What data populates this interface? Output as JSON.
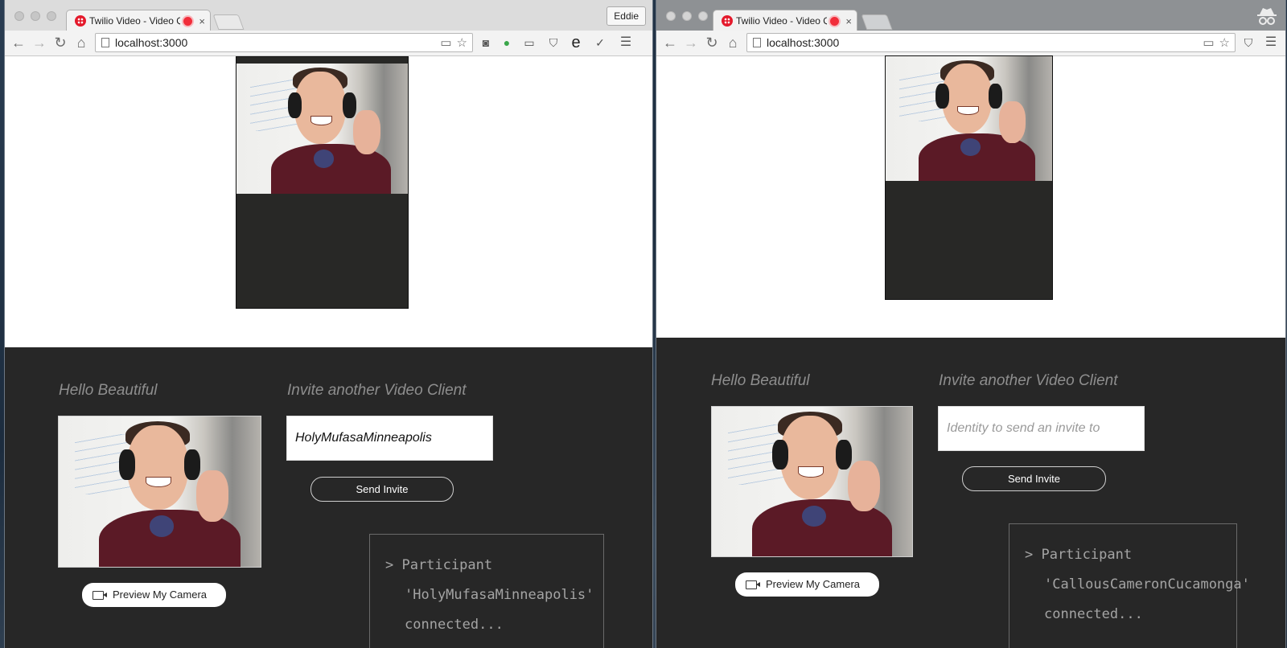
{
  "windows": [
    {
      "tab_title": "Twilio Video - Video Qu",
      "profile_name": "Eddie",
      "url": "localhost:3000",
      "heading_hello": "Hello Beautiful",
      "heading_invite": "Invite another Video Client",
      "invite_value": "HolyMufasaMinneapolis",
      "invite_placeholder": "Identity to send an invite to",
      "send_invite_label": "Send Invite",
      "preview_label": "Preview My Camera",
      "log_line1": "> Participant",
      "log_line2": "'HolyMufasaMinneapolis'",
      "log_line3": "connected..."
    },
    {
      "tab_title": "Twilio Video - Video Qu",
      "url": "localhost:3000",
      "heading_hello": "Hello Beautiful",
      "heading_invite": "Invite another Video Client",
      "invite_value": "",
      "invite_placeholder": "Identity to send an invite to",
      "send_invite_label": "Send Invite",
      "preview_label": "Preview My Camera",
      "log_line1": "> Participant",
      "log_line2": "'CallousCameronCucamonga'",
      "log_line3": "connected..."
    }
  ],
  "icons": {
    "back": "←",
    "forward": "→",
    "reload": "↻",
    "home": "⌂",
    "star": "☆",
    "menu": "☰",
    "close": "×"
  }
}
